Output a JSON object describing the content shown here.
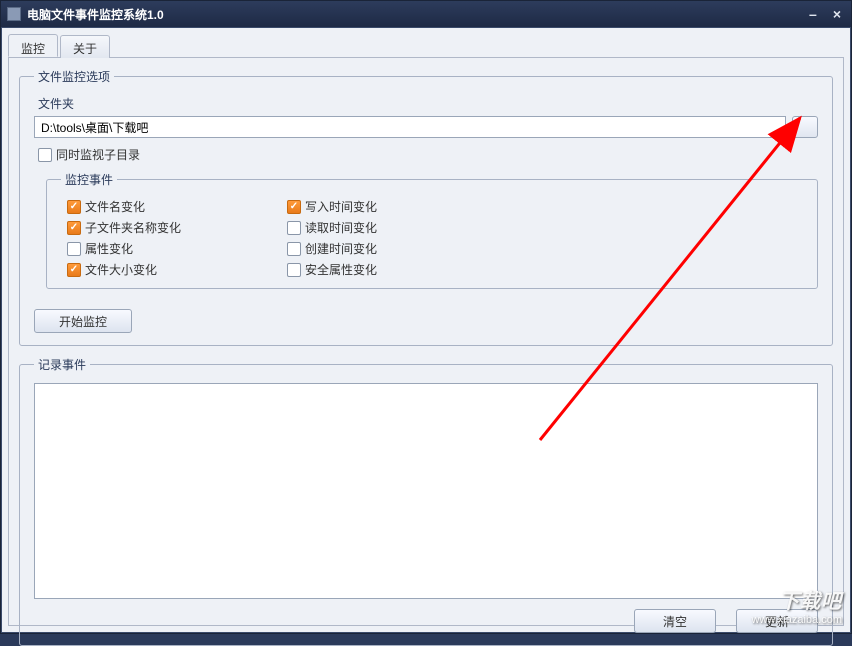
{
  "window": {
    "title": "电脑文件事件监控系统1.0"
  },
  "tabs": {
    "monitor": "监控",
    "about": "关于"
  },
  "options": {
    "legend": "文件监控选项",
    "folder_label": "文件夹",
    "folder_value": "D:\\tools\\桌面\\下载吧",
    "watch_subdirs_label": "同时监视子目录",
    "events_legend": "监控事件",
    "events": {
      "filename_change": "文件名变化",
      "subfolder_rename": "子文件夹名称变化",
      "attr_change": "属性变化",
      "size_change": "文件大小变化",
      "write_time": "写入时间变化",
      "read_time": "读取时间变化",
      "create_time": "创建时间变化",
      "security_attr": "安全属性变化"
    },
    "start_button": "开始监控"
  },
  "log": {
    "legend": "记录事件",
    "clear_button": "清空",
    "refresh_button": "更新"
  },
  "watermark": {
    "big": "下载吧",
    "url": "www.xiazaiba.com"
  }
}
